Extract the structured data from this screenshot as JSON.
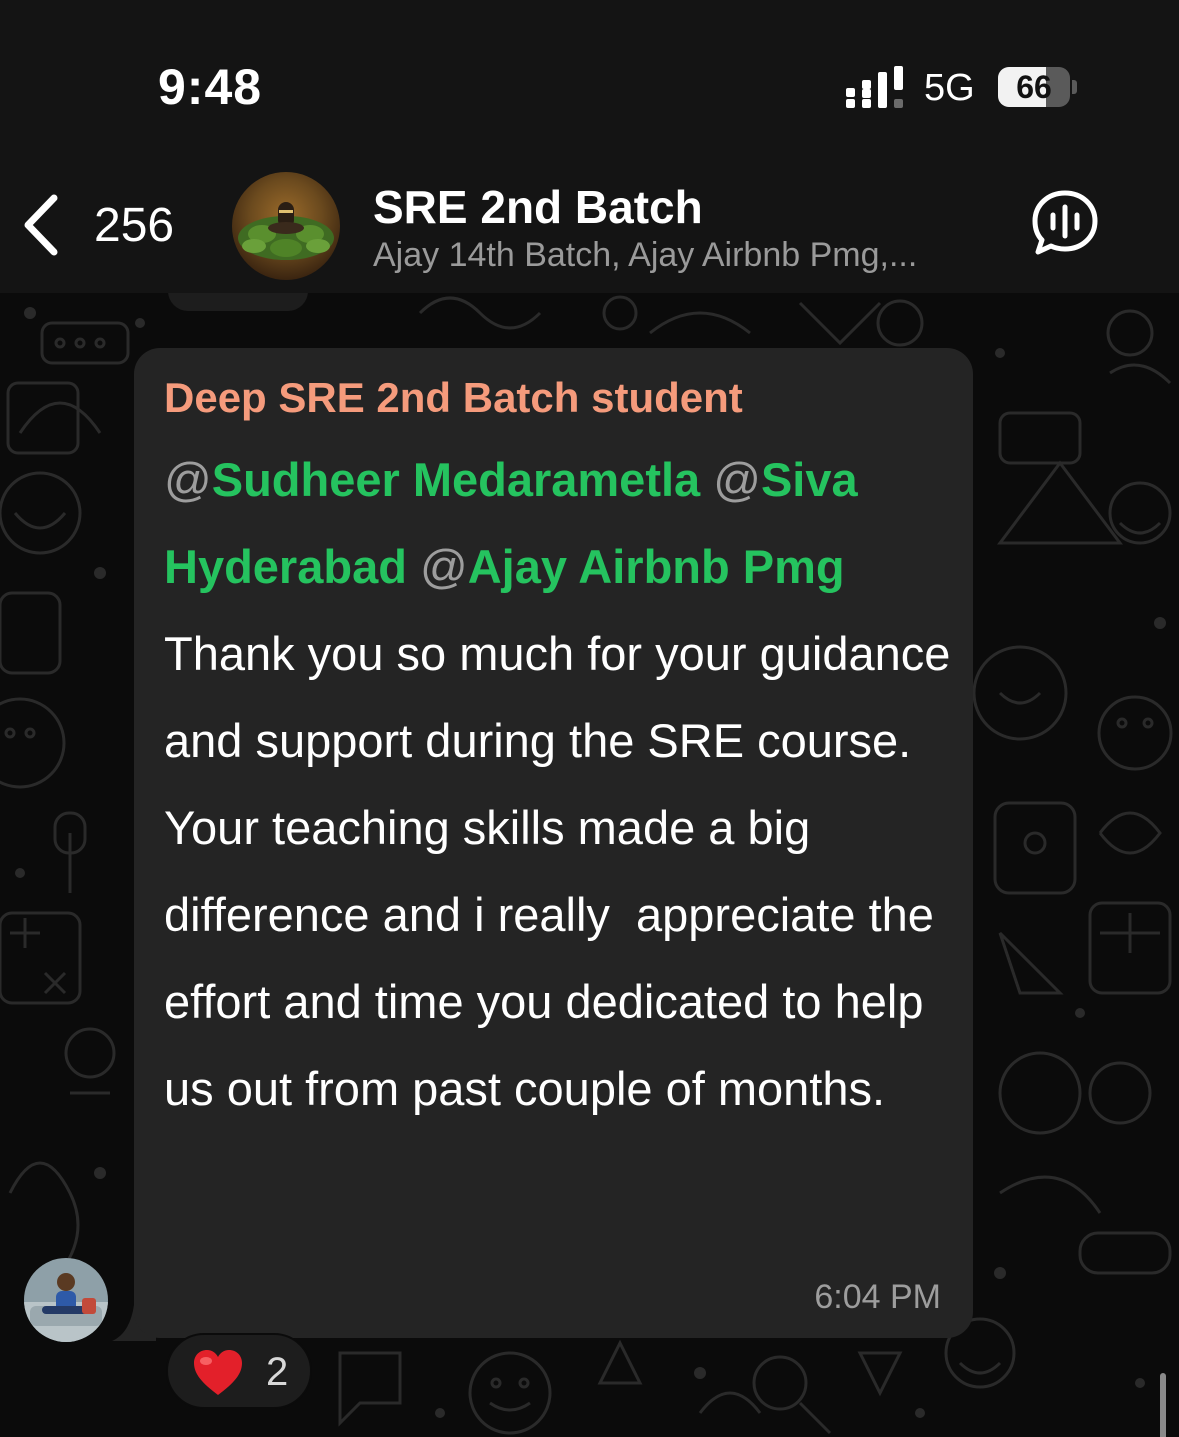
{
  "status_bar": {
    "time": "9:48",
    "network": "5G",
    "battery_level": "66",
    "battery_fraction": 0.66,
    "signal_icon": "cellular-signal-icon"
  },
  "header": {
    "back_count": "256",
    "title": "SRE 2nd Batch",
    "members": "Ajay 14th Batch, Ajay Airbnb Pmg,...",
    "avatar_icon": "group-avatar-image",
    "voice_chat_icon": "voice-chat-icon"
  },
  "message": {
    "sender": "Deep SRE 2nd Batch student",
    "mentions": [
      {
        "at": "@",
        "name": "Sudheer Medarametla"
      },
      {
        "at": "@",
        "name": "Siva Hyderabad"
      },
      {
        "at": "@",
        "name": "Ajay Airbnb Pmg"
      }
    ],
    "text_1": "Thank you so much for your guidance and support during the SRE course.",
    "text_2": "Your teaching skills made a big difference and i really  appreciate the effort and time you dedicated to help us out from past couple of months.",
    "time": "6:04 PM"
  },
  "reaction": {
    "emoji_icon": "red-heart-icon",
    "count": "2"
  },
  "colors": {
    "sender_name": "#f59b7c",
    "mention": "#25c35f",
    "bubble": "#242424",
    "background": "#0b0b0b"
  }
}
